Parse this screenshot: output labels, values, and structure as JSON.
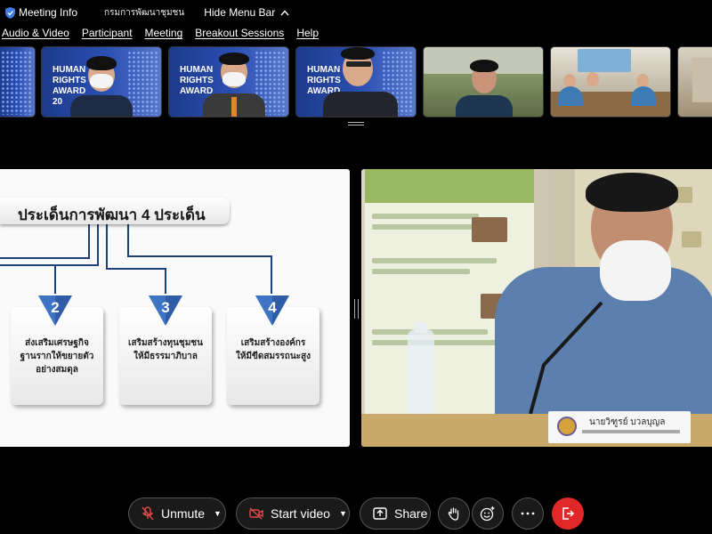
{
  "topbar": {
    "meeting_info": "Meeting Info",
    "org": "กรมการพัฒนาชุมชน",
    "hide_menu": "Hide Menu Bar"
  },
  "menu": [
    "Audio & Video",
    "Participant",
    "Meeting",
    "Breakout Sessions",
    "Help"
  ],
  "thumbnails": {
    "award_text": [
      "HUMAN",
      "RIGHTS",
      "AWARD"
    ],
    "award_year_fragment": "20"
  },
  "slide": {
    "title": "ประเด็นการพัฒนา 4 ประเด็น",
    "cards": [
      {
        "num": "2",
        "text": [
          "ส่งเสริมเศรษฐกิจ",
          "ฐานรากให้ขยายตัว",
          "อย่างสมดุล"
        ]
      },
      {
        "num": "3",
        "text": [
          "เสริมสร้างทุนชุมชน",
          "ให้มีธรรมาภิบาล"
        ]
      },
      {
        "num": "4",
        "text": [
          "เสริมสร้างองค์กร",
          "ให้มีขีดสมรรถนะสูง"
        ]
      }
    ]
  },
  "video": {
    "nameplate": "นายวิฑูรย์ บวลบุญล"
  },
  "toolbar": {
    "unmute": "Unmute",
    "start_video": "Start video",
    "share": "Share"
  },
  "colors": {
    "leave": "#e02828",
    "slide_line": "#1f3f7a",
    "badge": "#2f5da8"
  }
}
